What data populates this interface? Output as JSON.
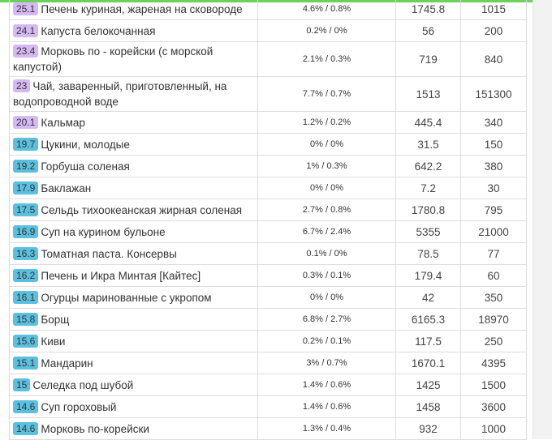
{
  "colors": {
    "badge_purple": "#d5b9f3",
    "badge_blue": "#5bc0de",
    "top_accent": "#6cd05a"
  },
  "rows": [
    {
      "score": "25.1",
      "name": "Печень куриная, жареная на сковороде",
      "pct": "4.6% / 0.8%",
      "a": "1745.8",
      "b": "1015",
      "badge": "purple"
    },
    {
      "score": "24.1",
      "name": "Капуста белокочанная",
      "pct": "0.2% / 0%",
      "a": "56",
      "b": "200",
      "badge": "purple"
    },
    {
      "score": "23.4",
      "name": "Морковь по - корейски (с морской капустой)",
      "pct": "2.1% / 0.3%",
      "a": "719",
      "b": "840",
      "badge": "purple"
    },
    {
      "score": "23",
      "name": "Чай, заваренный, приготовленный, на водопроводной воде",
      "pct": "7.7% / 0.7%",
      "a": "1513",
      "b": "151300",
      "badge": "purple"
    },
    {
      "score": "20.1",
      "name": "Кальмар",
      "pct": "1.2% / 0.2%",
      "a": "445.4",
      "b": "340",
      "badge": "purple"
    },
    {
      "score": "19.7",
      "name": "Цукини, молодые",
      "pct": "0% / 0%",
      "a": "31.5",
      "b": "150",
      "badge": "blue"
    },
    {
      "score": "19.2",
      "name": "Горбуша соленая",
      "pct": "1% / 0.3%",
      "a": "642.2",
      "b": "380",
      "badge": "blue"
    },
    {
      "score": "17.9",
      "name": "Баклажан",
      "pct": "0% / 0%",
      "a": "7.2",
      "b": "30",
      "badge": "blue"
    },
    {
      "score": "17.5",
      "name": "Сельдь тихоокеанская жирная соленая",
      "pct": "2.7% / 0.8%",
      "a": "1780.8",
      "b": "795",
      "badge": "blue"
    },
    {
      "score": "16.9",
      "name": "Суп на куриноm бульоне",
      "pct": "6.7% / 2.4%",
      "a": "5355",
      "b": "21000",
      "badge": "blue"
    },
    {
      "score": "16.3",
      "name": "Томатная паста. Консервы",
      "pct": "0.1% / 0%",
      "a": "78.5",
      "b": "77",
      "badge": "blue"
    },
    {
      "score": "16.2",
      "name": "Печень и Икра Минтая [Кайтес]",
      "pct": "0.3% / 0.1%",
      "a": "179.4",
      "b": "60",
      "badge": "blue"
    },
    {
      "score": "16.1",
      "name": "Огурцы маринованные с укропом",
      "pct": "0% / 0%",
      "a": "42",
      "b": "350",
      "badge": "blue"
    },
    {
      "score": "15.8",
      "name": "Борщ",
      "pct": "6.8% / 2.7%",
      "a": "6165.3",
      "b": "18970",
      "badge": "blue"
    },
    {
      "score": "15.6",
      "name": "Киви",
      "pct": "0.2% / 0.1%",
      "a": "117.5",
      "b": "250",
      "badge": "blue"
    },
    {
      "score": "15.1",
      "name": "Мандарин",
      "pct": "3% / 0.7%",
      "a": "1670.1",
      "b": "4395",
      "badge": "blue"
    },
    {
      "score": "15",
      "name": "Селедка под шубой",
      "pct": "1.4% / 0.6%",
      "a": "1425",
      "b": "1500",
      "badge": "blue"
    },
    {
      "score": "14.6",
      "name": "Суп гороховый",
      "pct": "1.4% / 0.6%",
      "a": "1458",
      "b": "3600",
      "badge": "blue"
    },
    {
      "score": "14.6",
      "name": "Морковь по-корейски",
      "pct": "1.3% / 0.4%",
      "a": "932",
      "b": "1000",
      "badge": "blue"
    }
  ]
}
